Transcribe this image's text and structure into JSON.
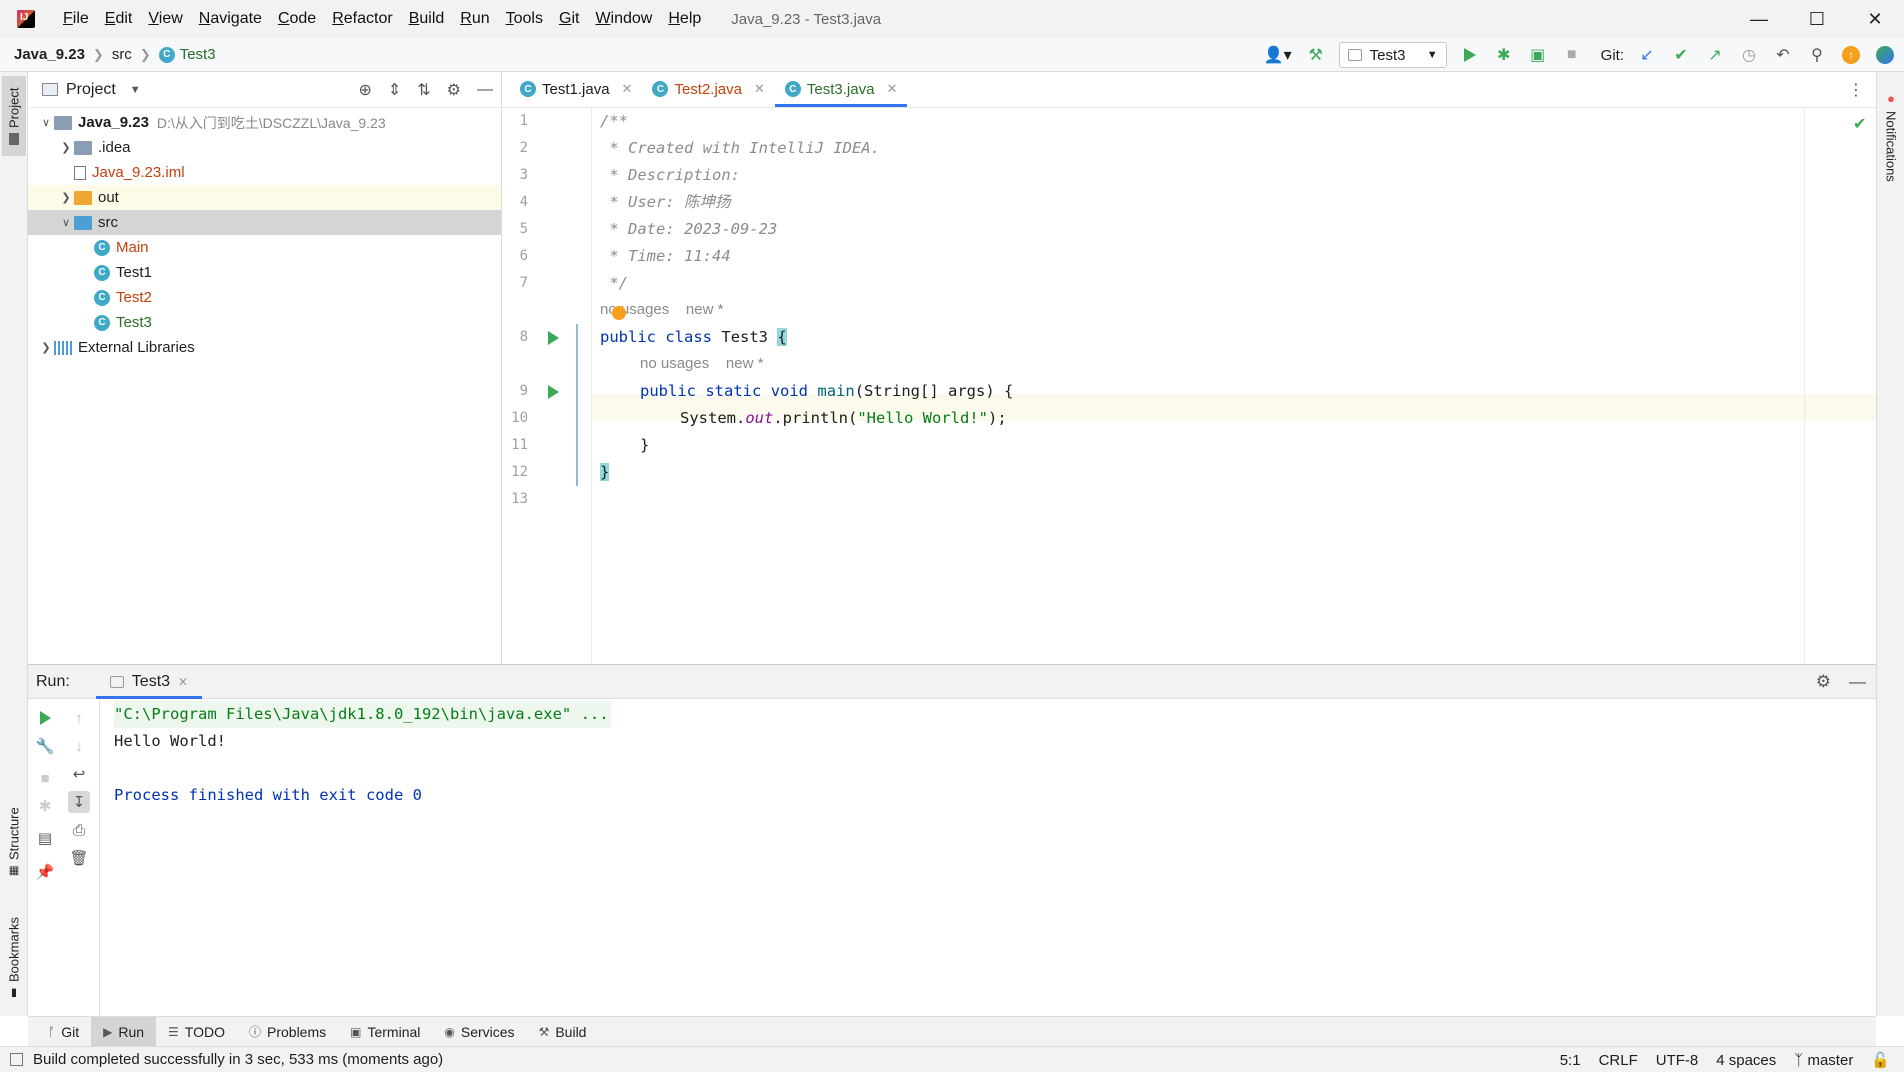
{
  "menubar": {
    "items": [
      "File",
      "Edit",
      "View",
      "Navigate",
      "Code",
      "Refactor",
      "Build",
      "Run",
      "Tools",
      "Git",
      "Window",
      "Help"
    ],
    "window_title": "Java_9.23 - Test3.java",
    "logo_text": "IJ"
  },
  "navbar": {
    "breadcrumbs": [
      "Java_9.23",
      "src",
      "Test3"
    ],
    "run_config": "Test3",
    "git_label": "Git:"
  },
  "project": {
    "title": "Project",
    "tree": [
      {
        "label": "Java_9.23",
        "path": "D:\\从入门到吃土\\DSCZZL\\Java_9.23",
        "type": "module",
        "indent": 0,
        "arrow": "expanded"
      },
      {
        "label": ".idea",
        "type": "folder",
        "indent": 1,
        "arrow": "collapsed"
      },
      {
        "label": "Java_9.23.iml",
        "type": "iml",
        "indent": 1,
        "arrow": "none"
      },
      {
        "label": "out",
        "type": "folder-orange",
        "indent": 1,
        "arrow": "collapsed"
      },
      {
        "label": "src",
        "type": "folder-blue",
        "indent": 1,
        "arrow": "expanded"
      },
      {
        "label": "Main",
        "type": "class",
        "indent": 2,
        "arrow": "none"
      },
      {
        "label": "Test1",
        "type": "class",
        "indent": 2,
        "arrow": "none"
      },
      {
        "label": "Test2",
        "type": "class",
        "indent": 2,
        "arrow": "none"
      },
      {
        "label": "Test3",
        "type": "class",
        "indent": 2,
        "arrow": "none"
      },
      {
        "label": "External Libraries",
        "type": "libs",
        "indent": 0,
        "arrow": "collapsed"
      }
    ]
  },
  "editor": {
    "tabs": [
      {
        "label": "Test1.java",
        "color": "#1e1e1e",
        "active": false
      },
      {
        "label": "Test2.java",
        "color": "#c2410c",
        "active": false
      },
      {
        "label": "Test3.java",
        "color": "#2b6e2b",
        "active": true
      }
    ],
    "line_numbers": [
      "1",
      "2",
      "3",
      "4",
      "5",
      "6",
      "7",
      "8",
      "9",
      "10",
      "11",
      "12",
      "13"
    ],
    "comment_lines": [
      "/**",
      " * Created with IntelliJ IDEA.",
      " * Description:",
      " * User: 陈坤扬",
      " * Date: 2023-09-23",
      " * Time: 11:44",
      " */"
    ],
    "hint1": {
      "usages": "no usages",
      "new": "new *"
    },
    "class_line": {
      "kw1": "public",
      "kw2": "class",
      "name": "Test3",
      "brace": "{"
    },
    "hint2": {
      "usages": "no usages",
      "new": "new *"
    },
    "main_line": {
      "kw1": "public",
      "kw2": "static",
      "kw3": "void",
      "name": "main",
      "rest": "(String[] args) {"
    },
    "println_line": {
      "prefix": "System.",
      "field": "out",
      "mid": ".println(",
      "str": "\"Hello World!\"",
      "end": ");"
    },
    "close_inner": "}",
    "close_outer": "}"
  },
  "run": {
    "label": "Run:",
    "tab": "Test3",
    "console": {
      "cmd": "\"C:\\Program Files\\Java\\jdk1.8.0_192\\bin\\java.exe\" ...",
      "output": "Hello World!",
      "exit": "Process finished with exit code 0"
    }
  },
  "left_tabs": {
    "project": "Project",
    "structure": "Structure",
    "bookmarks": "Bookmarks"
  },
  "right_tabs": {
    "notifications": "Notifications"
  },
  "tool_tabs": [
    {
      "label": "Git",
      "icon": "git-branch-icon",
      "active": false
    },
    {
      "label": "Run",
      "icon": "run-icon",
      "active": true
    },
    {
      "label": "TODO",
      "icon": "list-icon",
      "active": false
    },
    {
      "label": "Problems",
      "icon": "problems-icon",
      "active": false
    },
    {
      "label": "Terminal",
      "icon": "terminal-icon",
      "active": false
    },
    {
      "label": "Services",
      "icon": "services-icon",
      "active": false
    },
    {
      "label": "Build",
      "icon": "hammer-icon",
      "active": false
    }
  ],
  "status": {
    "message": "Build completed successfully in 3 sec, 533 ms (moments ago)",
    "position": "5:1",
    "line_sep": "CRLF",
    "encoding": "UTF-8",
    "indent": "4 spaces",
    "branch": "master"
  },
  "colors": {
    "accent": "#3574f0",
    "run_green": "#3ba955",
    "class_icon": "#3fa9c7"
  }
}
